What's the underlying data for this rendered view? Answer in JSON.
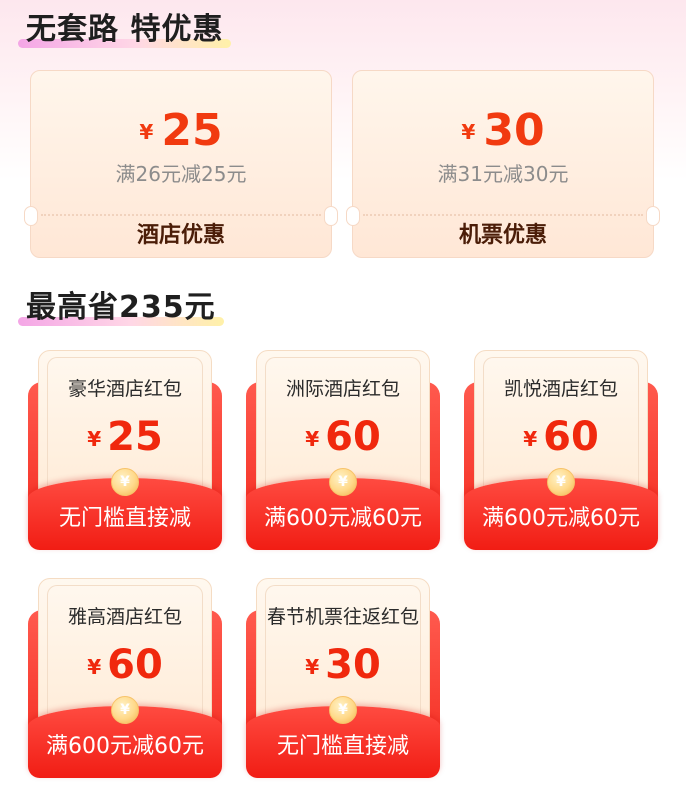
{
  "sections": {
    "title1": "无套路 特优惠",
    "title2": "最高省235元"
  },
  "top_coupons": [
    {
      "currency": "¥",
      "amount": "25",
      "condition": "满26元减25元",
      "label": "酒店优惠"
    },
    {
      "currency": "¥",
      "amount": "30",
      "condition": "满31元减30元",
      "label": "机票优惠"
    }
  ],
  "red_packets": [
    {
      "name": "豪华酒店红包",
      "currency": "¥",
      "amount": "25",
      "label": "无门槛直接减",
      "coin": "¥"
    },
    {
      "name": "洲际酒店红包",
      "currency": "¥",
      "amount": "60",
      "label": "满600元减60元",
      "coin": "¥"
    },
    {
      "name": "凯悦酒店红包",
      "currency": "¥",
      "amount": "60",
      "label": "满600元减60元",
      "coin": "¥"
    },
    {
      "name": "雅高酒店红包",
      "currency": "¥",
      "amount": "60",
      "label": "满600元减60元",
      "coin": "¥"
    },
    {
      "name": "春节机票往返红包",
      "currency": "¥",
      "amount": "30",
      "label": "无门槛直接减",
      "coin": "¥"
    }
  ],
  "colors": {
    "accent_red": "#f13a10",
    "packet_red": "#f3281c",
    "coupon_bg": "#ffe7d6",
    "highlight_start": "#f4a6e6",
    "highlight_end": "#fff1a8"
  }
}
